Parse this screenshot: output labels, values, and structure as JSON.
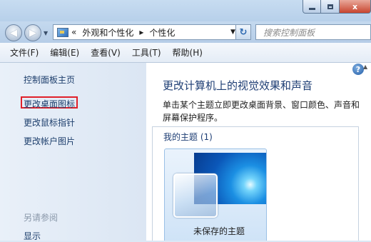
{
  "window": {
    "controls": {
      "minimize": "",
      "maximize": "",
      "close": "x"
    }
  },
  "navbar": {
    "breadcrumb_prefix": "«",
    "crumbs": [
      "外观和个性化",
      "个性化"
    ],
    "separator": "▸",
    "search_placeholder": "搜索控制面板"
  },
  "menu": {
    "items": [
      "文件(F)",
      "编辑(E)",
      "查看(V)",
      "工具(T)",
      "帮助(H)"
    ]
  },
  "sidebar": {
    "home": "控制面板主页",
    "links": [
      "更改桌面图标",
      "更改鼠标指针",
      "更改帐户图片"
    ],
    "see_also": "另请参阅",
    "display": "显示"
  },
  "content": {
    "title": "更改计算机上的视觉效果和声音",
    "description": "单击某个主题立即更改桌面背景、窗口颜色、声音和屏幕保护程序。",
    "my_themes": "我的主题 (1)",
    "theme_name": "未保存的主题",
    "help": "?"
  },
  "colors": {
    "highlight": "#e0202a",
    "link": "#1d3e6c",
    "title": "#1e3e74"
  }
}
